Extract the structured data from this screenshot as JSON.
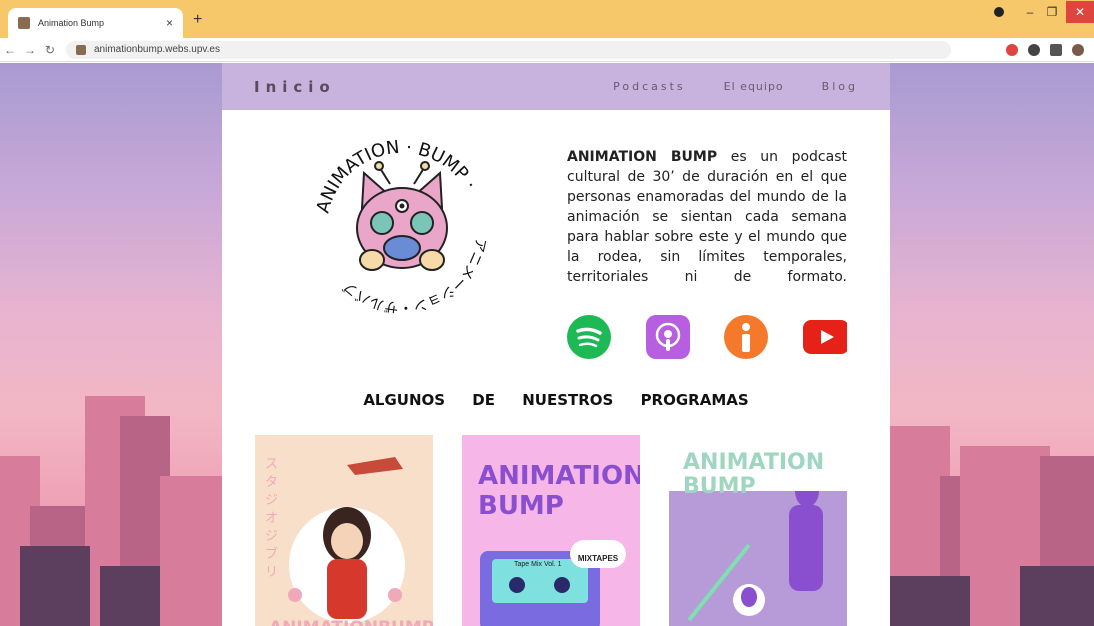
{
  "browser": {
    "tab_title": "Animation Bump",
    "url": "animationbump.webs.upv.es",
    "new_tab_glyph": "+",
    "close_glyph": "×"
  },
  "nav": {
    "home": "Inicio",
    "links": [
      "Podcasts",
      "El equipo",
      "Blog"
    ]
  },
  "logo": {
    "ring_text": "ANIMATION · BUMP ·",
    "jp_text": "アニメーション・ザルバブ"
  },
  "intro": {
    "brand": "ANIMATION BUMP",
    "text": " es un podcast cultural de 30’ de duración en el que personas enamoradas del mundo de la animación se sientan cada semana para hablar sobre este y el mundo que la rodea,  sin límites temporales, territoriales ni de formato."
  },
  "social": [
    {
      "icon": "spotify-icon",
      "color": "#1db954"
    },
    {
      "icon": "apple-podcasts-icon",
      "color": "#b85ee0"
    },
    {
      "icon": "ivoox-icon",
      "color": "#f4792b"
    },
    {
      "icon": "youtube-icon",
      "color": "#e62117"
    }
  ],
  "programs": {
    "heading": "ALGUNOS DE NUESTROS PROGRAMAS",
    "items": [
      {
        "title": "ANIMATIONBUMP",
        "side_text": "スタジオジブリ"
      },
      {
        "title": "ANIMATION BUMP",
        "tag": "MIXTAPES",
        "cassette_label": "Tape Mix Vol. 1"
      },
      {
        "title": "ANIMATION BUMP"
      }
    ]
  },
  "colors": {
    "tabbar": "#f7c86a",
    "nav_bg": "#c8b3df",
    "accent_purple": "#8a4fcf"
  }
}
